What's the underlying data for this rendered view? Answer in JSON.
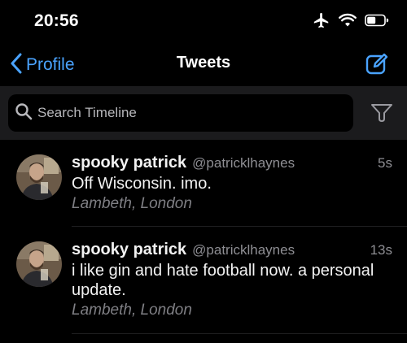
{
  "status_bar": {
    "time": "20:56",
    "icons": [
      "airplane-icon",
      "wifi-icon",
      "battery-icon"
    ]
  },
  "nav": {
    "back_label": "Profile",
    "title": "Tweets",
    "compose_icon": "compose-icon"
  },
  "search": {
    "placeholder": "Search Timeline",
    "filter_icon": "filter-icon"
  },
  "colors": {
    "accent": "#4aa3ff",
    "background": "#000000",
    "search_row_bg": "#1b1b1d",
    "secondary_text": "#8e8e93"
  },
  "tweets": [
    {
      "name": "spooky patrick",
      "handle": "@patricklhaynes",
      "time": "5s",
      "text": "Off Wisconsin. imo.",
      "location": "Lambeth, London"
    },
    {
      "name": "spooky patrick",
      "handle": "@patricklhaynes",
      "time": "13s",
      "text": "i like gin and hate football now. a personal update.",
      "location": "Lambeth, London"
    }
  ]
}
